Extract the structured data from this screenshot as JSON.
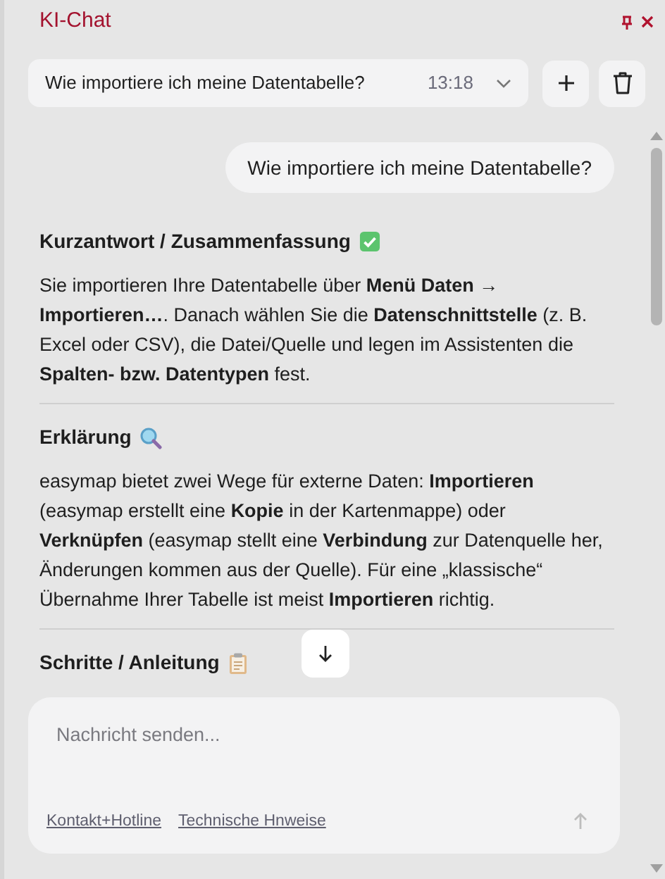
{
  "window": {
    "title": "KI-Chat"
  },
  "conversation": {
    "title": "Wie importiere ich meine Datentabelle?",
    "time": "13:18"
  },
  "user_message": "Wie importiere ich meine Datentabelle?",
  "sections": [
    {
      "heading": "Kurzantwort / Zusammenfassung",
      "kind": "check",
      "body": "Sie importieren Ihre Datentabelle über **Menü Daten → Importieren…**. Danach wählen Sie die **Datenschnittstelle** (z. B. Excel oder CSV), die Datei/Quelle und legen im Assistenten die **Spalten- bzw. Datentypen** fest."
    },
    {
      "heading": "Erklärung",
      "kind": "search",
      "body": "easymap bietet zwei Wege für externe Daten: **Importieren** (easymap erstellt eine **Kopie** in der Kartenmappe) oder **Verknüpfen** (easymap stellt eine **Verbindung** zur Datenquelle her, Änderungen kommen aus der Quelle). Für eine „klassische“ Übernahme Ihrer Tabelle ist meist **Importieren** richtig."
    },
    {
      "heading": "Schritte / Anleitung",
      "kind": "clipboard"
    }
  ],
  "composer": {
    "placeholder": "Nachricht senden...",
    "links": [
      "Kontakt+Hotline",
      "Technische Hnweise"
    ]
  }
}
